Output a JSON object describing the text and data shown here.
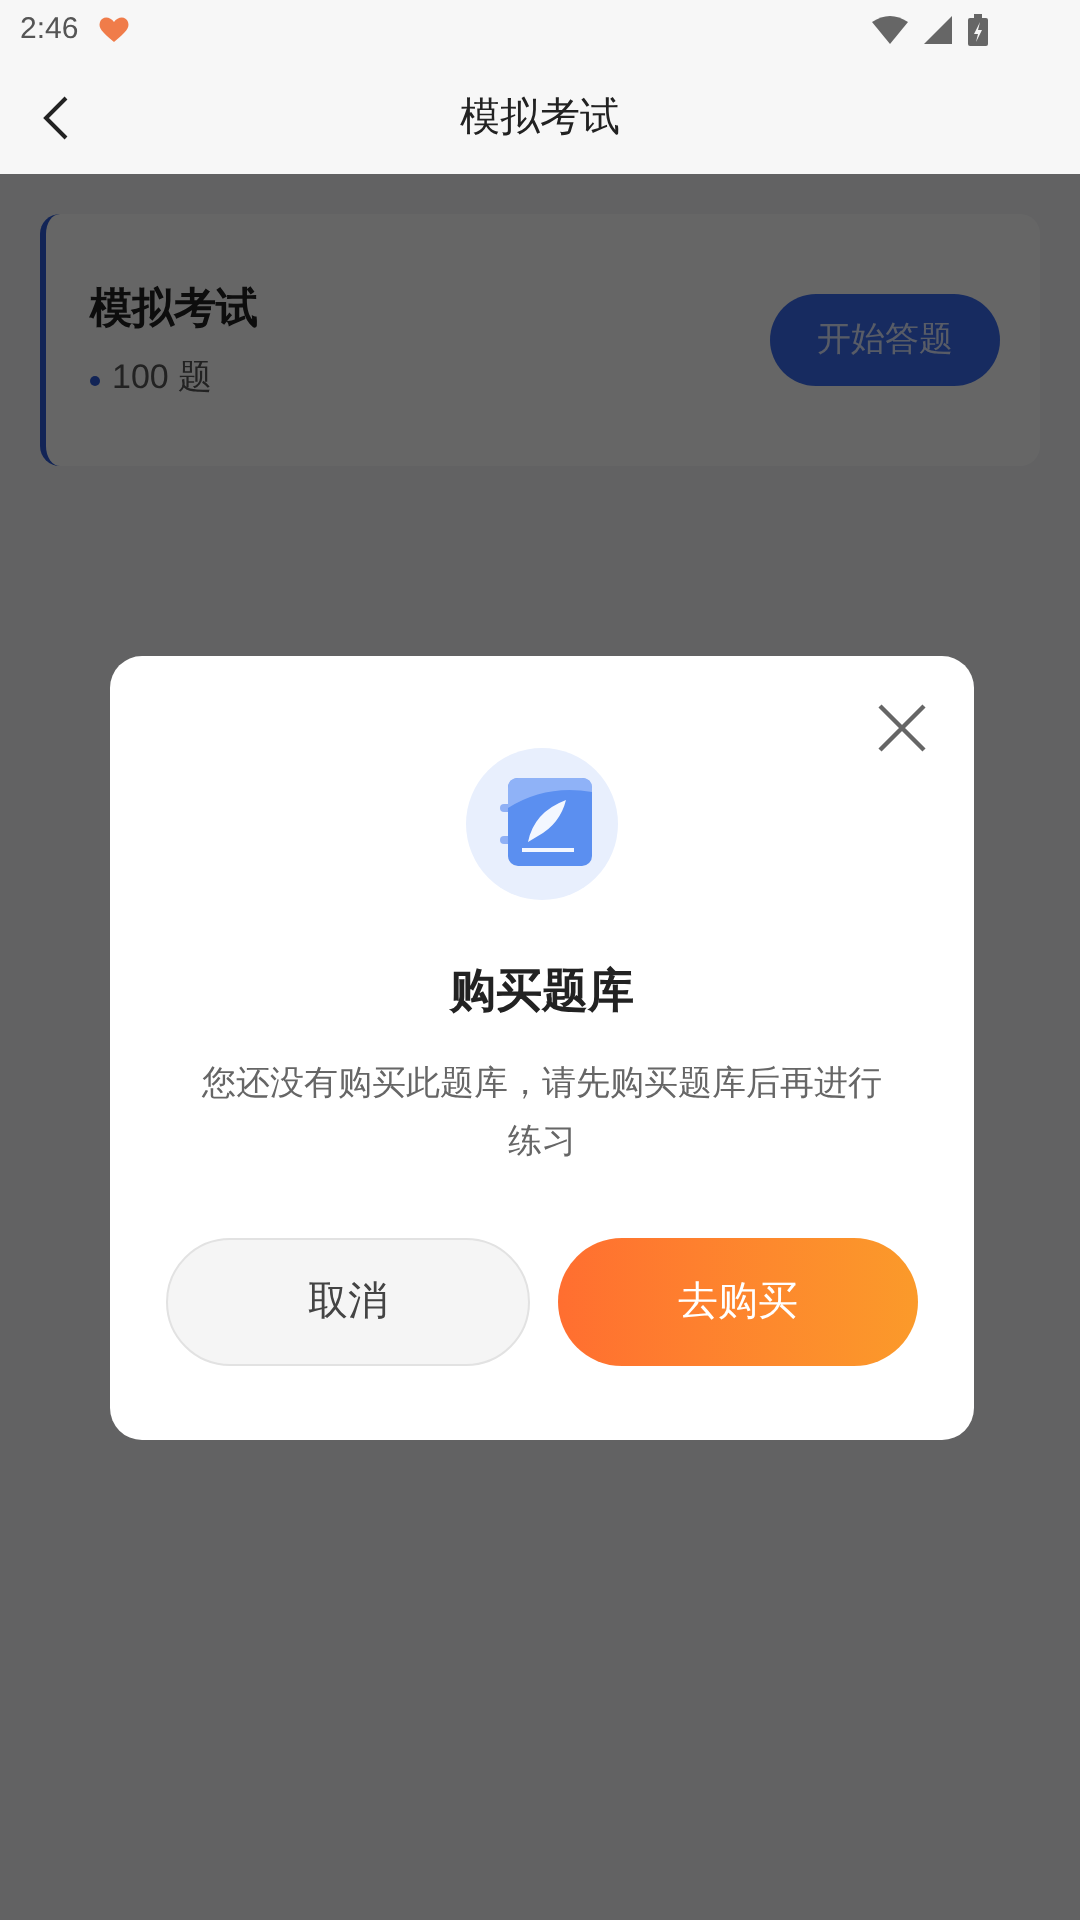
{
  "status_bar": {
    "time": "2:46"
  },
  "header": {
    "title": "模拟考试"
  },
  "exam_card": {
    "title": "模拟考试",
    "count": "100 题",
    "button": "开始答题"
  },
  "dialog": {
    "title": "购买题库",
    "message": "您还没有购买此题库，请先购买题库后再进行练习",
    "buttons": [
      {
        "label": "取消",
        "kind": "secondary"
      },
      {
        "label": "去购买",
        "kind": "primary"
      }
    ]
  }
}
